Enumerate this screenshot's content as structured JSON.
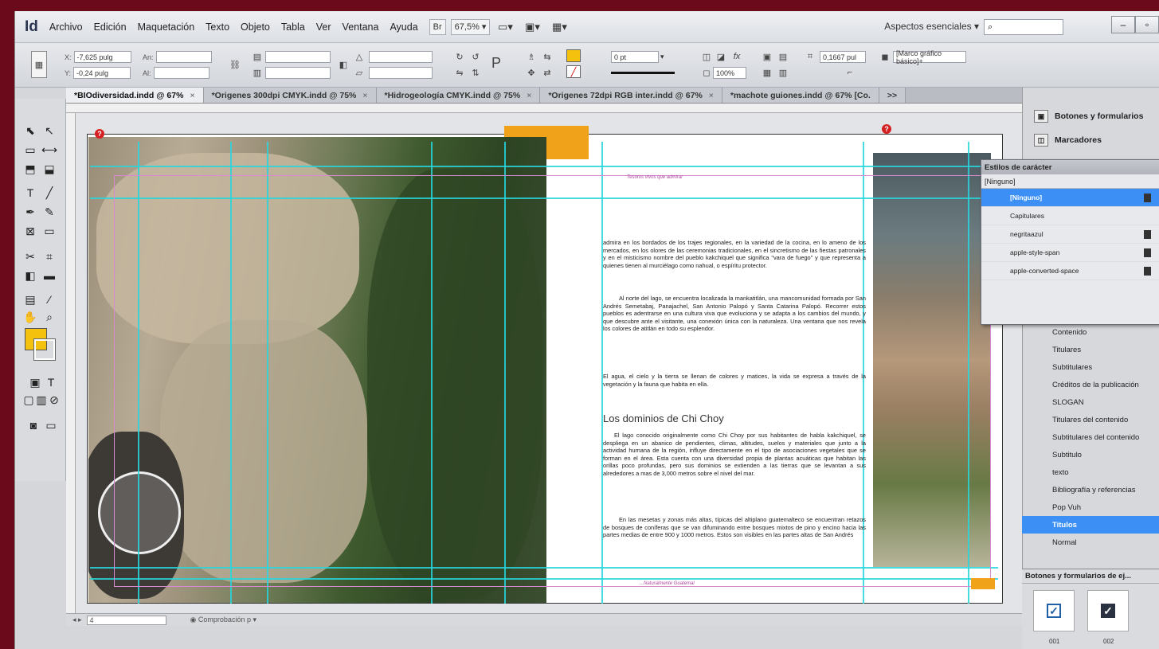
{
  "app": {
    "logo": "Id",
    "menu": [
      "Archivo",
      "Edición",
      "Maquetación",
      "Texto",
      "Objeto",
      "Tabla",
      "Ver",
      "Ventana",
      "Ayuda"
    ],
    "bridge_label": "Br",
    "zoom": "67,5%",
    "workspace": "Aspectos esenciales",
    "search_placeholder": ""
  },
  "control": {
    "x_label": "X:",
    "x_value": "-7,625 pulg",
    "y_label": "Y:",
    "y_value": "-0,24 pulg",
    "w_label": "An:",
    "h_label": "Al:",
    "stroke_weight": "0 pt",
    "opacity": "100%",
    "offset": "0,1667 pul",
    "frame_style": "[Marco gráfico básico]+"
  },
  "tabs": [
    {
      "label": "*BIOdiversidad.indd @ 67%",
      "active": true
    },
    {
      "label": "*Origenes 300dpi CMYK.indd @ 75%",
      "active": false
    },
    {
      "label": "*Hidrogeología CMYK.indd @ 75%",
      "active": false
    },
    {
      "label": "*Origenes 72dpi RGB inter.indd @ 67%",
      "active": false
    },
    {
      "label": "*machote guiones.indd @ 67% [Co.",
      "active": false
    }
  ],
  "tab_close": "×",
  "tab_overflow": ">>",
  "page": {
    "running_header": "Tesoros vivos que admirar",
    "running_footer": "...Naturalmente Guatemal",
    "para1": "admira en los bordados de los trajes regionales, en la variedad de la cocina, en lo ameno de los mercados, en los olores de las ceremonias tradicionales, en el sincretismo de las fiestas patronales y en el misticismo nombre del pueblo kakchiquel que significa \"vara de fuego\" y que representa a quienes tienen al murciélago como nahual, o espíritu protector.",
    "para2": "Al norte del lago, se encuentra localizada la mankatitlán, una mancomunidad formada por San Andrés Semetabaj, Panajachel, San Antonio Palopó y Santa Catarina Palopó. Recorrer estos pueblos es adentrarse en una cultura viva que evoluciona y se adapta a los cambios del mundo, y que descubre ante el visitante, una conexión única con la naturaleza. Una ventana que nos revela los colores de atitlán en todo su esplendor.",
    "para3": "El agua, el cielo y la tierra se llenan de colores y matices, la vida se expresa a través de la vegetación y la fauna que habita en ella.",
    "heading": "Los dominios de Chi Choy",
    "para4": "El lago conocido originalmente como Chi Choy por sus habitantes de habla kakchiquel, se despliega en un abanico de pendientes, climas, altitudes, suelos y materiales que junto a la actividad humana de la región, influye directamente en el tipo de asociaciones vegetales que se forman en el área. Esta cuenta con una diversidad propia de plantas acuáticas que habitan las orillas poco profundas, pero sus dominios se extienden a las tierras que se levantan a sus alrededores a mas de 3,000 metros sobre el nivel del mar.",
    "para5": "En las mesetas y zonas más altas, típicas del altiplano guatemalteco se encuentran retazos de bosques de coníferas que se van difuminando entre bosques mixtos de pino y encino hacia las partes medias de entre 900 y 1000 metros. Estos son visibles en las partes altas de San Andrés"
  },
  "status": {
    "page_num": "4",
    "preflight": "Comprobación p",
    "arrows": "◂ ▸"
  },
  "right_panel": {
    "buttons_forms": "Botones y formularios",
    "bookmarks": "Marcadores",
    "styles": [
      "Contenido",
      "Titulares",
      "Subtitulares",
      "Créditos de la publicación",
      "SLOGAN",
      "Titulares del contenido",
      "Subtitulares del contenido",
      "Subtitulo",
      "texto",
      "Bibliografía y referencias",
      "Pop Vuh",
      "Titulos",
      "Normal"
    ],
    "selected_style": "Titulos"
  },
  "char_styles": {
    "title": "Estilos de carácter",
    "current": "[Ninguno]",
    "items": [
      "[Ninguno]",
      "Capitulares",
      "negritaazul",
      "apple-style-span",
      "apple-converted-space"
    ],
    "selected": "[Ninguno]"
  },
  "buttons_forms_panel": {
    "title": "Botones y formularios de ej...",
    "labels": [
      "001",
      "002"
    ]
  },
  "colors": {
    "accent_yellow": "#f4c10f",
    "guide_cyan": "#27d6de",
    "selection_blue": "#3b8ff5",
    "margin_pink": "#d68ad0"
  }
}
